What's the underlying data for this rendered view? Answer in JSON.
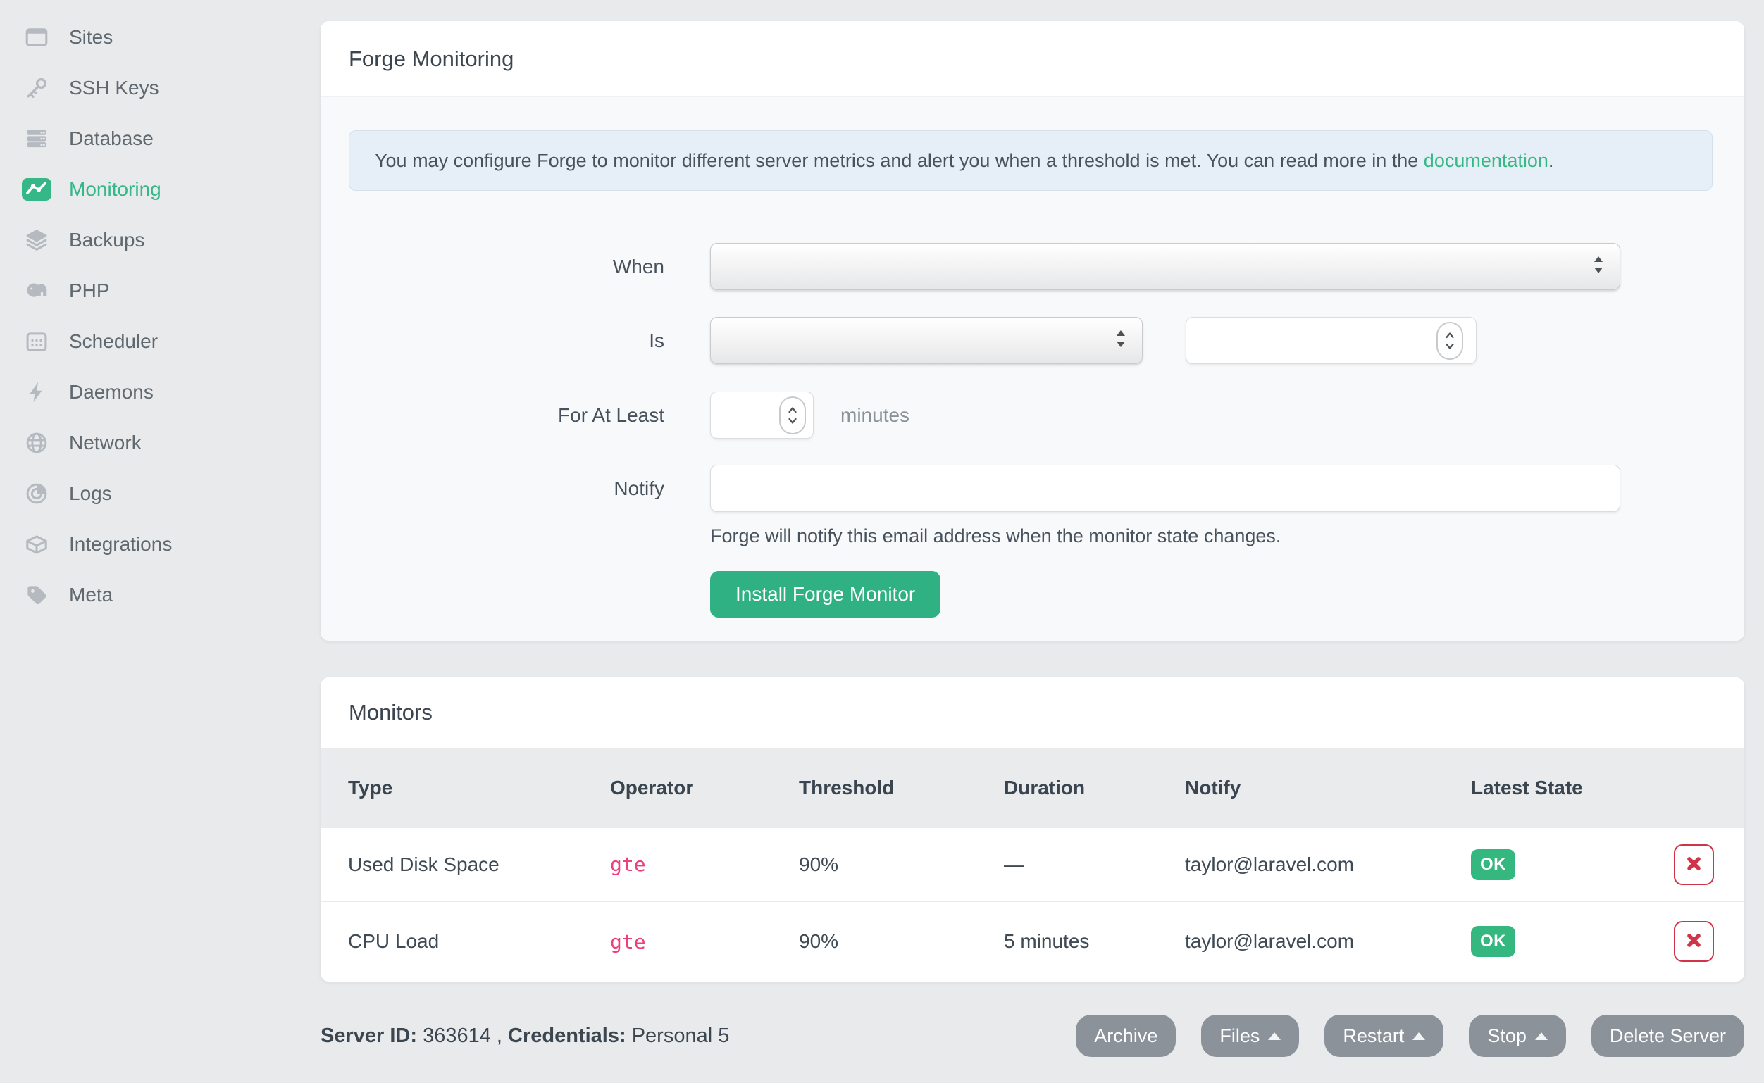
{
  "sidebar": {
    "items": [
      {
        "label": "Sites"
      },
      {
        "label": "SSH Keys"
      },
      {
        "label": "Database"
      },
      {
        "label": "Monitoring",
        "active": true
      },
      {
        "label": "Backups"
      },
      {
        "label": "PHP"
      },
      {
        "label": "Scheduler"
      },
      {
        "label": "Daemons"
      },
      {
        "label": "Network"
      },
      {
        "label": "Logs"
      },
      {
        "label": "Integrations"
      },
      {
        "label": "Meta"
      }
    ]
  },
  "monitoring_card": {
    "title": "Forge Monitoring",
    "alert": {
      "text": "You may configure Forge to monitor different server metrics and alert you when a threshold is met. You can read more in the ",
      "link_label": "documentation",
      "text_after": "."
    },
    "form": {
      "when_label": "When",
      "when_value": "",
      "is_label": "Is",
      "is_operator_value": "",
      "is_threshold_value": "",
      "for_at_least_label": "For At Least",
      "for_at_least_value": "",
      "minutes_suffix": "minutes",
      "notify_label": "Notify",
      "notify_value": "",
      "notify_help": "Forge will notify this email address when the monitor state changes.",
      "submit_label": "Install Forge Monitor"
    }
  },
  "monitors_card": {
    "title": "Monitors",
    "columns": [
      "Type",
      "Operator",
      "Threshold",
      "Duration",
      "Notify",
      "Latest State"
    ],
    "rows": [
      {
        "type": "Used Disk Space",
        "operator": "gte",
        "threshold": "90%",
        "duration": "—",
        "notify": "taylor@laravel.com",
        "state": "OK"
      },
      {
        "type": "CPU Load",
        "operator": "gte",
        "threshold": "90%",
        "duration": "5 minutes",
        "notify": "taylor@laravel.com",
        "state": "OK"
      }
    ]
  },
  "footer": {
    "server_id_label": "Server ID:",
    "server_id_value": "363614",
    "separator": " , ",
    "credentials_label": "Credentials:",
    "credentials_value": "Personal 5",
    "buttons": [
      {
        "label": "Archive",
        "caret": false
      },
      {
        "label": "Files",
        "caret": true
      },
      {
        "label": "Restart",
        "caret": true
      },
      {
        "label": "Stop",
        "caret": true
      },
      {
        "label": "Delete Server",
        "caret": false
      }
    ]
  },
  "colors": {
    "accent_green": "#36b787",
    "link_green": "#38b885",
    "operator_pink": "#ef3e7e",
    "danger_red": "#d13448",
    "footer_button_gray": "#8b9299",
    "alert_background": "#e6eff7",
    "page_background": "#e9eaec"
  }
}
